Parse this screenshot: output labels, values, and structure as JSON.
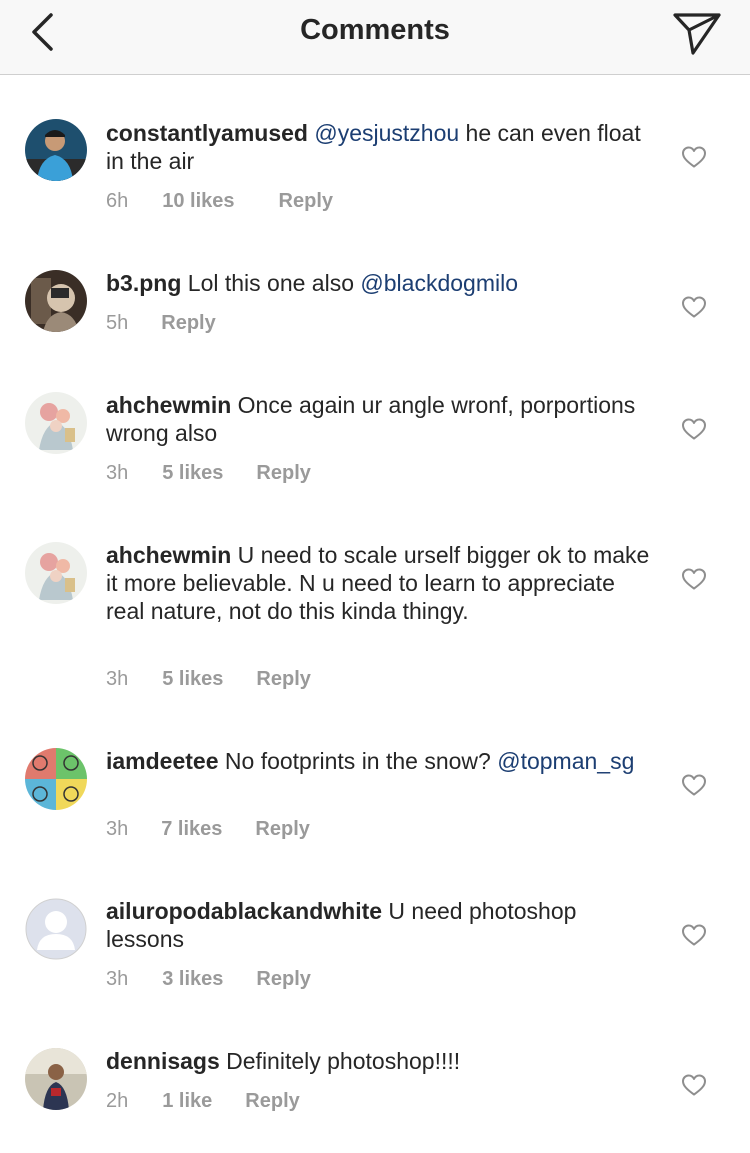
{
  "header": {
    "title": "Comments",
    "back_icon": "chevron-left-icon",
    "send_icon": "direct-send-icon"
  },
  "colors": {
    "mention": "#1c3e72",
    "meta": "#9a9a9a",
    "text": "#262626"
  },
  "comments": [
    {
      "username": "constantlyamused",
      "pre": "",
      "mention": "@yesjustzhou",
      "post": " he can even float in the air",
      "time": "6h",
      "likes": "10 likes",
      "reply": "Reply"
    },
    {
      "username": "b3.png",
      "pre": " Lol this one also ",
      "mention": "@blackdogmilo",
      "post": "",
      "time": "5h",
      "likes": "",
      "reply": "Reply"
    },
    {
      "username": "ahchewmin",
      "pre": " Once again ur angle wronf, porportions wrong also",
      "mention": "",
      "post": "",
      "time": "3h",
      "likes": "5 likes",
      "reply": "Reply"
    },
    {
      "username": "ahchewmin",
      "pre": " U need to scale urself bigger ok to make it more believable. N u need to learn to appreciate real nature, not do this kinda thingy.",
      "mention": "",
      "post": "",
      "time": "3h",
      "likes": "5 likes",
      "reply": "Reply"
    },
    {
      "username": "iamdeetee",
      "pre": " No footprints in the snow? ",
      "mention": "@topman_sg",
      "post": "",
      "time": "3h",
      "likes": "7 likes",
      "reply": "Reply"
    },
    {
      "username": "ailuropodablackandwhite",
      "pre": " U need photoshop lessons",
      "mention": "",
      "post": "",
      "time": "3h",
      "likes": "3 likes",
      "reply": "Reply"
    },
    {
      "username": "dennisags",
      "pre": " Definitely photoshop!!!!",
      "mention": "",
      "post": "",
      "time": "2h",
      "likes": "1 like",
      "reply": "Reply"
    }
  ]
}
